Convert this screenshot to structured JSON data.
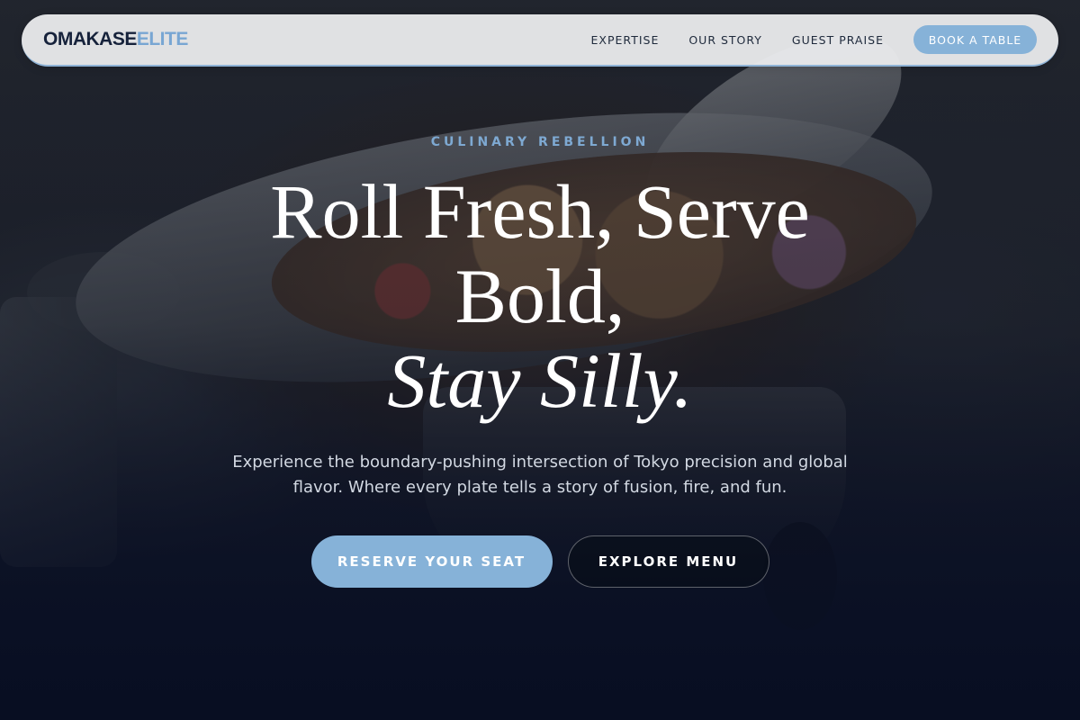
{
  "brand": {
    "name_part1": "OMAKASE",
    "name_part2": "ELITE",
    "accent_color": "#78a6d3",
    "dark_color": "#16223b"
  },
  "nav": {
    "links": [
      "EXPERTISE",
      "OUR STORY",
      "GUEST PRAISE"
    ],
    "cta_label": "BOOK A TABLE"
  },
  "hero": {
    "eyebrow": "CULINARY REBELLION",
    "headline_line1": "Roll Fresh, Serve",
    "headline_line2": "Bold,",
    "headline_line3": "Stay Silly.",
    "subtext": "Experience the boundary-pushing intersection of Tokyo precision and global flavor. Where every plate tells a story of fusion, fire, and fun.",
    "primary_cta": "RESERVE YOUR SEAT",
    "secondary_cta": "EXPLORE MENU"
  }
}
